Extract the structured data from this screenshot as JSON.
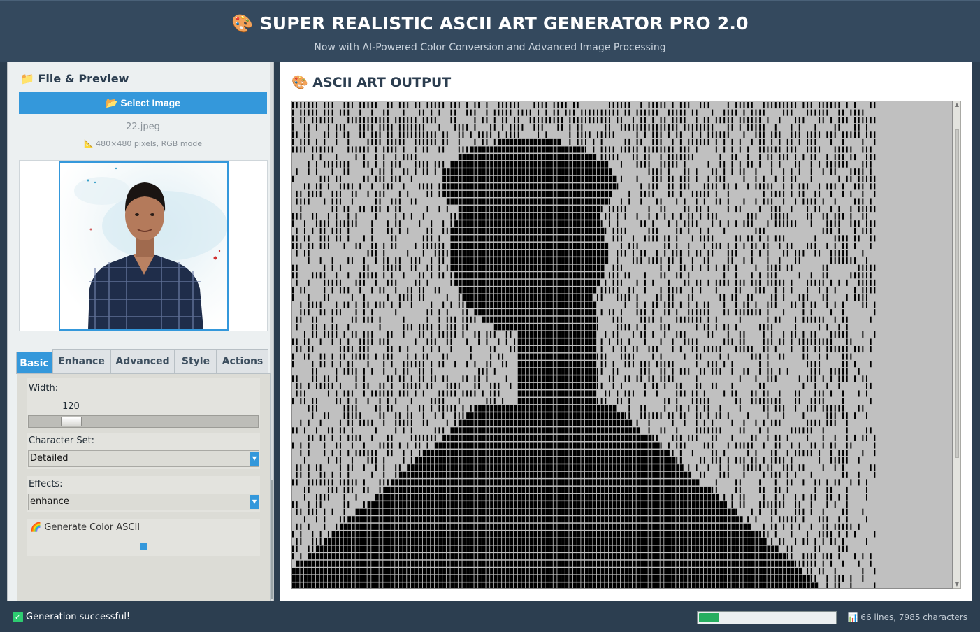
{
  "header": {
    "title": "🎨 SUPER REALISTIC ASCII ART GENERATOR PRO 2.0",
    "subtitle": "Now with AI-Powered Color Conversion and Advanced Image Processing"
  },
  "file_panel": {
    "title": "📁 File & Preview",
    "select_button": "📂 Select Image",
    "file_name": "22.jpeg",
    "file_info": "📐 480×480 pixels, RGB mode"
  },
  "tabs": [
    {
      "label": "Basic",
      "active": true
    },
    {
      "label": "Enhance",
      "active": false
    },
    {
      "label": "Advanced",
      "active": false
    },
    {
      "label": "Style",
      "active": false
    },
    {
      "label": "Actions",
      "active": false
    }
  ],
  "basic": {
    "width_label": "Width:",
    "width_value": "120",
    "width_slider_value": 120,
    "charset_label": "Character Set:",
    "charset_value": "Detailed",
    "effects_label": "Effects:",
    "effects_value": "enhance",
    "color_ascii_label": "🌈 Generate Color ASCII",
    "color_ascii_checked": true
  },
  "output": {
    "title": "🎨 ASCII ART OUTPUT"
  },
  "status": {
    "message": "Generation successful!",
    "progress": 0.15,
    "stats": "📊 66 lines, 7985 characters"
  },
  "colors": {
    "accent": "#3498db",
    "header_bg": "#34495e",
    "ascii_bg": "#c0c0c0",
    "ascii_fg": "#000000",
    "success": "#27ae60"
  }
}
